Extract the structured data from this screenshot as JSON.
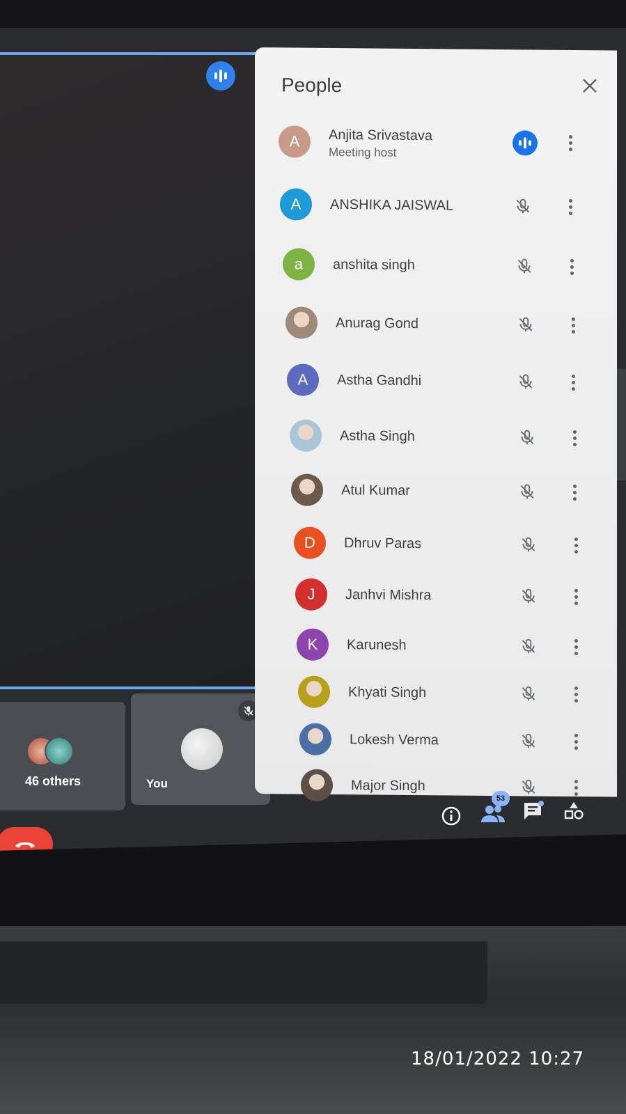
{
  "panel": {
    "title": "People",
    "participants": [
      {
        "initial": "A",
        "name": "Anjita Srivastava",
        "subtitle": "Meeting host",
        "color": "#c89a8a",
        "status": "speaking"
      },
      {
        "initial": "A",
        "name": "ANSHIKA JAISWAL",
        "color": "#1e9bd7",
        "status": "muted"
      },
      {
        "initial": "a",
        "name": "anshita singh",
        "color": "#7cb342",
        "status": "muted"
      },
      {
        "initial": "",
        "name": "Anurag Gond",
        "color": "#9e8a7a",
        "status": "muted",
        "photo": true
      },
      {
        "initial": "A",
        "name": "Astha Gandhi",
        "color": "#5c6bc0",
        "status": "muted"
      },
      {
        "initial": "",
        "name": "Astha Singh",
        "color": "#a9c6d9",
        "status": "muted",
        "photo": true
      },
      {
        "initial": "",
        "name": "Atul Kumar",
        "color": "#6d5a4a",
        "status": "muted",
        "photo": true
      },
      {
        "initial": "D",
        "name": "Dhruv Paras",
        "color": "#e8501f",
        "status": "muted"
      },
      {
        "initial": "J",
        "name": "Janhvi Mishra",
        "color": "#d32f2f",
        "status": "muted"
      },
      {
        "initial": "K",
        "name": "Karunesh",
        "color": "#8e44ad",
        "status": "muted"
      },
      {
        "initial": "",
        "name": "Khyati Singh",
        "color": "#b7a11a",
        "status": "muted",
        "photo": true
      },
      {
        "initial": "",
        "name": "Lokesh Verma",
        "color": "#4a6fa5",
        "status": "muted",
        "photo": true
      },
      {
        "initial": "",
        "name": "Major Singh",
        "color": "#5d4e46",
        "status": "muted",
        "photo": true
      }
    ]
  },
  "tiles": {
    "others_label": "46 others",
    "you_label": "You"
  },
  "toolbar": {
    "people_count": "53",
    "icons": [
      "info-icon",
      "people-icon",
      "chat-icon",
      "activities-icon"
    ]
  },
  "timestamp": "18/01/2022 10:27",
  "colors": {
    "accent": "#1a73e8",
    "end_call": "#ea4335",
    "tile_border": "#6aa8f2"
  }
}
